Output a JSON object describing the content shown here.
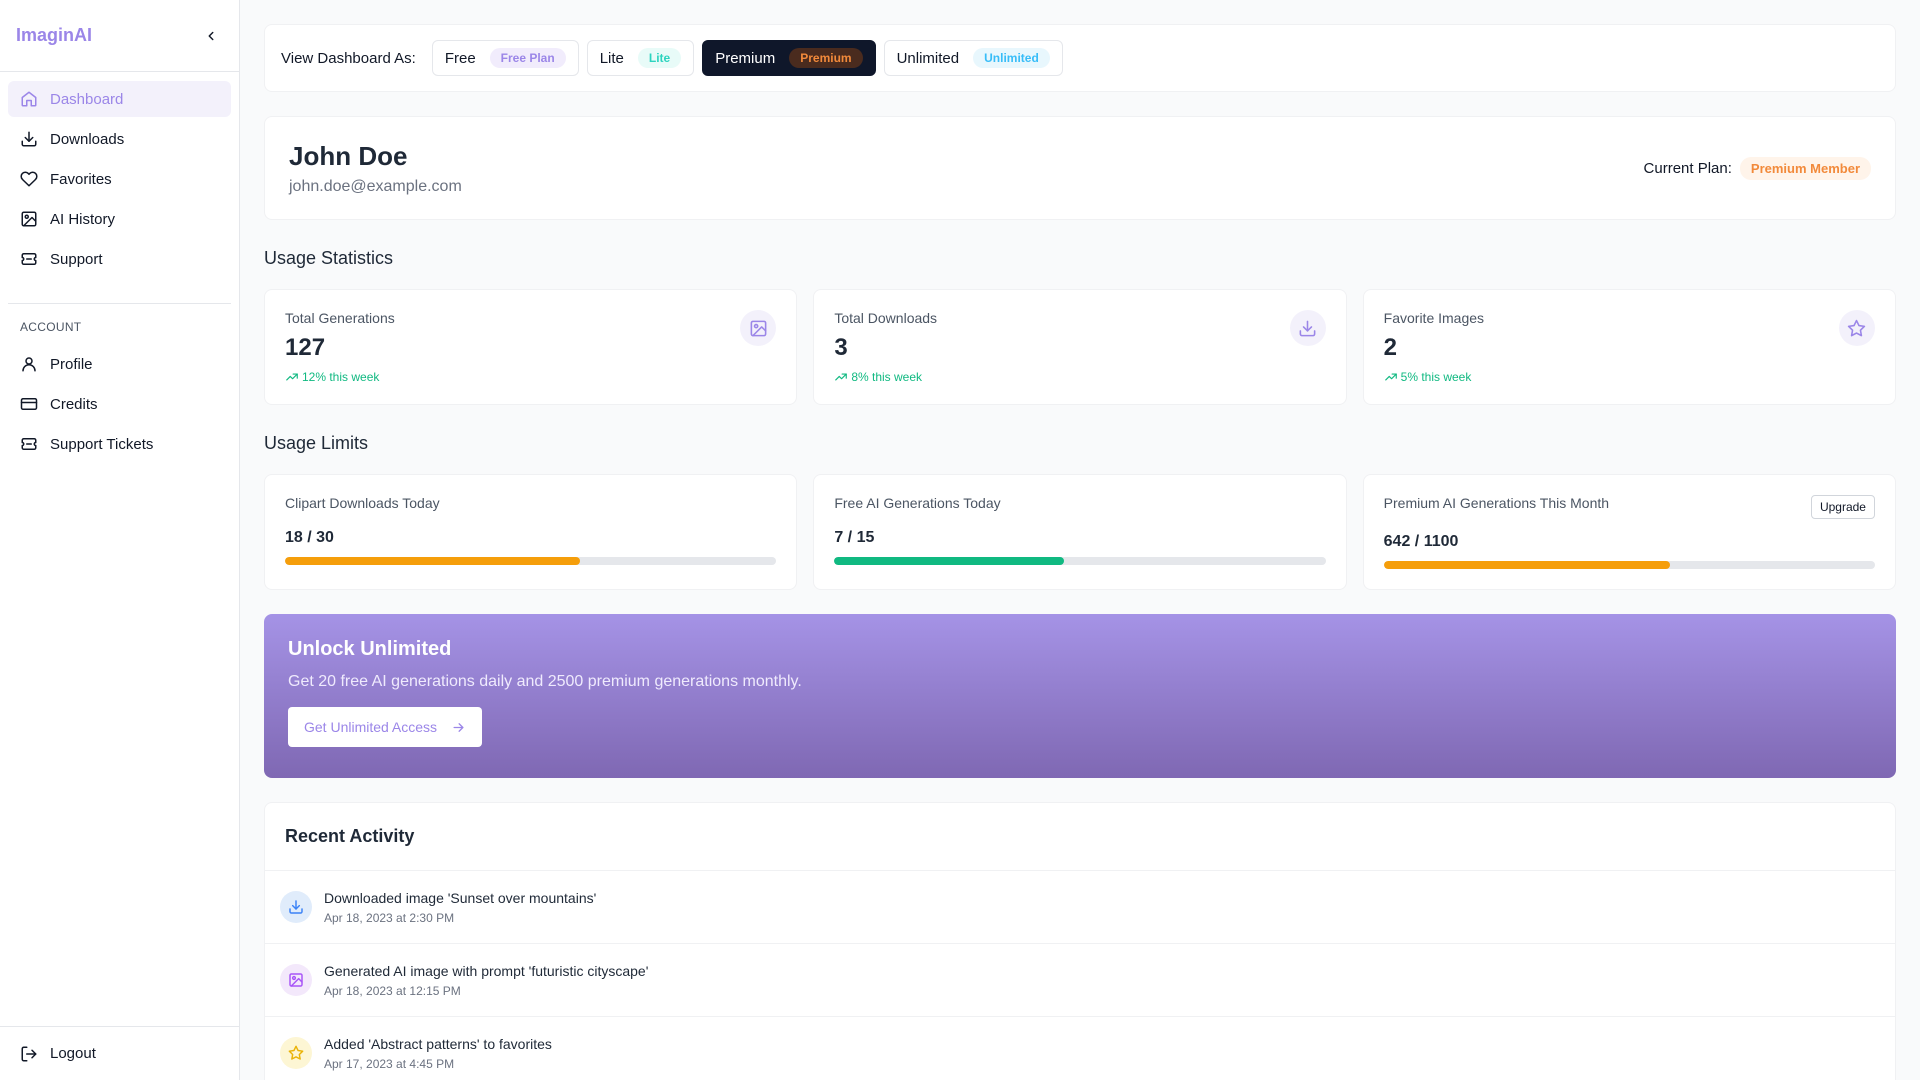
{
  "app": {
    "brand": "ImaginAI"
  },
  "sidebar": {
    "nav": [
      {
        "label": "Dashboard",
        "icon": "home-icon",
        "active": true
      },
      {
        "label": "Downloads",
        "icon": "download-icon"
      },
      {
        "label": "Favorites",
        "icon": "heart-icon"
      },
      {
        "label": "AI History",
        "icon": "image-icon"
      },
      {
        "label": "Support",
        "icon": "ticket-icon"
      }
    ],
    "account_label": "ACCOUNT",
    "account": [
      {
        "label": "Profile",
        "icon": "user-icon"
      },
      {
        "label": "Credits",
        "icon": "credit-card-icon"
      },
      {
        "label": "Support Tickets",
        "icon": "ticket-icon"
      }
    ],
    "logout": "Logout"
  },
  "viewbar": {
    "label": "View Dashboard As:",
    "plans": [
      {
        "label": "Free",
        "badge": "Free Plan",
        "badge_bg": "#f1ecfc",
        "badge_color": "#9b86e8"
      },
      {
        "label": "Lite",
        "badge": "Lite",
        "badge_bg": "#e8fbf8",
        "badge_color": "#2dd4bf"
      },
      {
        "label": "Premium",
        "badge": "Premium",
        "badge_bg": "#4a2b1e",
        "badge_color": "#f28a3b",
        "active": true
      },
      {
        "label": "Unlimited",
        "badge": "Unlimited",
        "badge_bg": "#e8f7fd",
        "badge_color": "#38bdf8"
      }
    ]
  },
  "profile": {
    "name": "John Doe",
    "email": "john.doe@example.com",
    "current_plan_label": "Current Plan:",
    "current_plan": "Premium Member"
  },
  "usage_stats": {
    "title": "Usage Statistics",
    "items": [
      {
        "label": "Total Generations",
        "value": "127",
        "trend": "12% this week",
        "icon": "image-icon"
      },
      {
        "label": "Total Downloads",
        "value": "3",
        "trend": "8% this week",
        "icon": "download-icon"
      },
      {
        "label": "Favorite Images",
        "value": "2",
        "trend": "5% this week",
        "icon": "star-icon"
      }
    ]
  },
  "usage_limits": {
    "title": "Usage Limits",
    "items": [
      {
        "label": "Clipart Downloads Today",
        "value": "18 / 30",
        "fraction": 0.6,
        "color": "#f59e0b"
      },
      {
        "label": "Free AI Generations Today",
        "value": "7 / 15",
        "fraction": 0.4667,
        "color": "#10b981"
      },
      {
        "label": "Premium AI Generations This Month",
        "value": "642 / 1100",
        "fraction": 0.5836,
        "color": "#f59e0b",
        "action": "Upgrade"
      }
    ]
  },
  "banner": {
    "title": "Unlock Unlimited",
    "subtitle": "Get 20 free AI generations daily and 2500 premium generations monthly.",
    "button": "Get Unlimited Access"
  },
  "activity": {
    "title": "Recent Activity",
    "items": [
      {
        "text": "Downloaded image 'Sunset over mountains'",
        "time": "Apr 18, 2023 at 2:30 PM",
        "icon": "download-icon",
        "bg": "#e0ecfb",
        "color": "#3b82f6"
      },
      {
        "text": "Generated AI image with prompt 'futuristic cityscape'",
        "time": "Apr 18, 2023 at 12:15 PM",
        "icon": "image-icon",
        "bg": "#f3e8fb",
        "color": "#a855f7"
      },
      {
        "text": "Added 'Abstract patterns' to favorites",
        "time": "Apr 17, 2023 at 4:45 PM",
        "icon": "star-icon",
        "bg": "#fdf6d4",
        "color": "#eab308"
      }
    ]
  }
}
